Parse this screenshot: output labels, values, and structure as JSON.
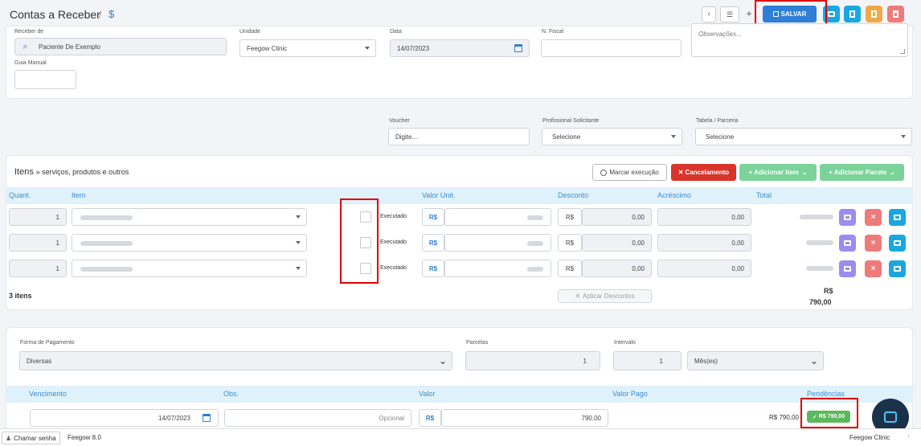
{
  "header": {
    "title": "Contas a Receber",
    "sep": "/",
    "currency_symbol": "$",
    "save_label": "SALVAR"
  },
  "form": {
    "receber_de_label": "Receber de",
    "receber_de_value": "Paciente De Exemplo",
    "unidade_label": "Unidade",
    "unidade_value": "Feegow Clinic",
    "data_label": "Data",
    "data_value": "14/07/2023",
    "nfiscal_label": "N. Fiscal",
    "obs_placeholder": "Observações...",
    "guia_label": "Guia Manual"
  },
  "extra": {
    "voucher_label": "Voucher",
    "voucher_placeholder": "Digite...",
    "prof_label": "Profissional Solicitante",
    "prof_value": "Selecione",
    "tabela_label": "Tabela / Parceria",
    "tabela_value": "Selecione"
  },
  "items": {
    "title_bold": "Itens",
    "title_rest": "» serviços, produtos e outros",
    "marcar_label": "Marcar execução",
    "cancel_label": "Cancelamento",
    "add_item_label": "Adicionar Item",
    "add_pacote_label": "Adicionar Pacote",
    "columns": [
      "Quant.",
      "Item",
      "Valor Unit.",
      "Desconto",
      "Acréscimo",
      "Total"
    ],
    "rows": [
      {
        "qty": "1",
        "exec_label": "Executado",
        "currency": "R$",
        "desc_currency": "R$",
        "desconto": "0,00",
        "acrescimo": "0,00"
      },
      {
        "qty": "1",
        "exec_label": "Executado",
        "currency": "R$",
        "desc_currency": "R$",
        "desconto": "0,00",
        "acrescimo": "0,00"
      },
      {
        "qty": "1",
        "exec_label": "Executado",
        "currency": "R$",
        "desc_currency": "R$",
        "desconto": "0,00",
        "acrescimo": "0,00"
      }
    ],
    "count_label": "3 itens",
    "aplicar_label": "Aplicar Descontos",
    "total_currency": "R$",
    "total_value": "790,00"
  },
  "payment": {
    "forma_label": "Forma de Pagamento",
    "forma_value": "Diversas",
    "parcelas_label": "Parcelas",
    "parcelas_value": "1",
    "intervalo_label": "Intervalo",
    "intervalo_value": "1",
    "periodo_value": "Mês(es)",
    "columns": [
      "Vencimento",
      "Obs.",
      "Valor",
      "Valor Pago",
      "Pendências"
    ],
    "row": {
      "vencimento": "14/07/2023",
      "obs_placeholder": "Opcional",
      "currency": "R$",
      "valor": "790,00",
      "valor_pago": "R$ 790,00",
      "pendencia": "R$ 790,00"
    }
  },
  "footer": {
    "chamar_label": "Chamar senha",
    "version": "Feegow 8.0",
    "clinic": "Feegow Clinic"
  },
  "colors": {
    "primary": "#2f7fd6",
    "red": "#d9332a",
    "green": "#5cb85c",
    "highlight": "#e00000"
  }
}
